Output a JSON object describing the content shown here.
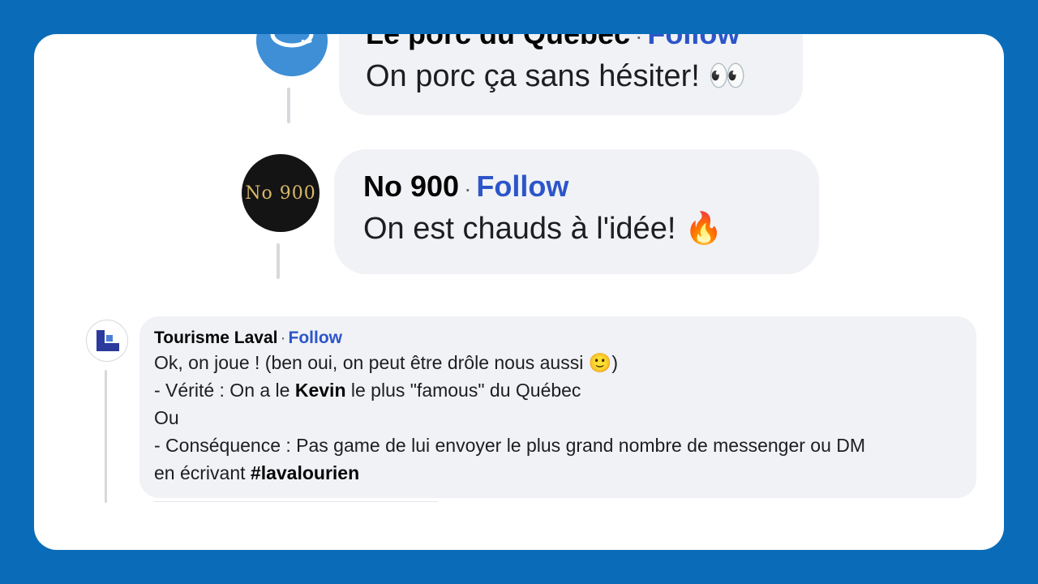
{
  "comments": [
    {
      "author": "Le porc du Québec",
      "separator": "·",
      "follow_label": "Follow",
      "text": "On porc ça sans hésiter!",
      "emoji": "👀"
    },
    {
      "author": "No 900",
      "avatar_text": "No 900",
      "separator": "·",
      "follow_label": "Follow",
      "text": "On est chauds à l'idée!",
      "emoji": "🔥"
    },
    {
      "author": "Tourisme Laval",
      "separator": "·",
      "follow_label": "Follow",
      "line1": "Ok, on joue ! (ben oui, on peut être drôle nous aussi",
      "line1_emoji": "🙂",
      "line1_end": ")",
      "line2_a": "- Vérité : On a le ",
      "line2_bold": "Kevin",
      "line2_b": " le plus \"famous\" du Québec",
      "line3": "Ou",
      "line4": "- Conséquence : Pas game de lui envoyer le plus grand nombre de messenger ou DM",
      "line5_a": "en écrivant ",
      "line5_bold": "#lavalourien"
    }
  ],
  "colors": {
    "frame": "#0a6cb8",
    "bubble": "#f0f2f5",
    "follow": "#2d55c9"
  }
}
